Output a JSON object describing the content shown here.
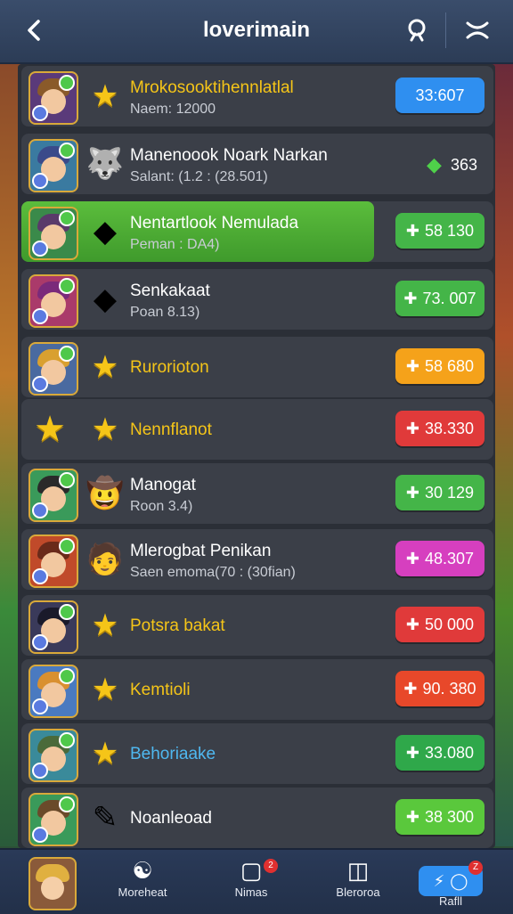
{
  "header": {
    "title": "loverimain",
    "back_icon": "chevron-left-icon",
    "search_icon": "search-icon",
    "close_icon": "close-icon"
  },
  "rows": [
    {
      "name": "Mrokosooktihennlatlal",
      "sub": "Naem: 12000",
      "price": "33:607",
      "price_color": "#2f8ff0",
      "name_color": "#f5c518",
      "icon": "★",
      "icon_name": "star-icon",
      "hair": "#8a5a2a",
      "avatar_bg": "#5a3a7a"
    },
    {
      "name": "Manenoook Noark Narkan",
      "sub": "Salant: (1.2 : (28.501)",
      "price": "363",
      "price_color": "",
      "name_color": "#ffffff",
      "icon": "🐺",
      "icon_name": "wolf-icon",
      "hair": "#3a4a8a",
      "avatar_bg": "#3a7aa0"
    },
    {
      "name": "Nentartlook Nemulada",
      "sub": "Peman : DA4)",
      "price": "58 130",
      "price_color": "#44b548",
      "name_color": "#ffffff",
      "icon": "◆",
      "icon_name": "diamond-badge-icon",
      "hair": "#5a3a6a",
      "avatar_bg": "#3a8a4a"
    },
    {
      "name": "Senkakaat",
      "sub": "Poan 8.13)",
      "price": "73. 007",
      "price_color": "#44b548",
      "name_color": "#ffffff",
      "icon": "◆",
      "icon_name": "diamond-badge-icon",
      "hair": "#7a2a7a",
      "avatar_bg": "#aa3a6a"
    },
    {
      "name": "Rurorioton",
      "sub": "",
      "price": "58 680",
      "price_color": "#f5a21a",
      "name_color": "#f5c518",
      "icon": "★",
      "icon_name": "star-icon",
      "hair": "#d9a030",
      "avatar_bg": "#4a6aa0"
    },
    {
      "name": "Nennflanot",
      "sub": "",
      "price": "38.330",
      "price_color": "#e03a3a",
      "name_color": "#f5c518",
      "icon": "★",
      "icon_name": "star-icon",
      "hair": "#f5c518",
      "avatar_bg": "#3b3f48"
    },
    {
      "name": "Manogat",
      "sub": "Roon 3.4)",
      "price": "30 129",
      "price_color": "#44b548",
      "name_color": "#ffffff",
      "icon": "🤠",
      "icon_name": "cowboy-icon",
      "hair": "#2a2a2a",
      "avatar_bg": "#3a9a5a"
    },
    {
      "name": "Mlerogbat Penikan",
      "sub": "Saen emoma(70 : (30fian)",
      "price": "48.307",
      "price_color": "#d63fbf",
      "name_color": "#ffffff",
      "icon": "🧑",
      "icon_name": "hero-icon",
      "hair": "#6a2a1a",
      "avatar_bg": "#c04a2a"
    },
    {
      "name": "Potsra bakat",
      "sub": "",
      "price": "50 000",
      "price_color": "#e03a3a",
      "name_color": "#f5c518",
      "icon": "★",
      "icon_name": "star-icon",
      "hair": "#1a1a2a",
      "avatar_bg": "#3a3a5a"
    },
    {
      "name": "Kemtioli",
      "sub": "",
      "price": "90. 380",
      "price_color": "#e8482a",
      "name_color": "#f5c518",
      "icon": "★",
      "icon_name": "star-icon",
      "hair": "#d99030",
      "avatar_bg": "#4a7ac0"
    },
    {
      "name": "Behoriaake",
      "sub": "",
      "price": "33.080",
      "price_color": "#2fa84a",
      "name_color": "#4fb8f0",
      "icon": "★",
      "icon_name": "star-icon",
      "hair": "#4a6a3a",
      "avatar_bg": "#3a8a9a"
    },
    {
      "name": "Noanleoad",
      "sub": "",
      "price": "38 300",
      "price_color": "#5ac83c",
      "name_color": "#ffffff",
      "icon": "✎",
      "icon_name": "quill-icon",
      "hair": "#6a4a2a",
      "avatar_bg": "#3a9a5a"
    }
  ],
  "nav": {
    "items": [
      {
        "label": "Moreheat",
        "icon": "☯",
        "icon_name": "profile-swirl-icon"
      },
      {
        "label": "Nimas",
        "icon": "▢",
        "icon_name": "message-icon",
        "badge": "2"
      },
      {
        "label": "Bleroroa",
        "icon": "◫",
        "icon_name": "bag-icon"
      },
      {
        "label": "Rafll",
        "icon": "⚡",
        "icon_name": "chat-icon"
      }
    ]
  }
}
